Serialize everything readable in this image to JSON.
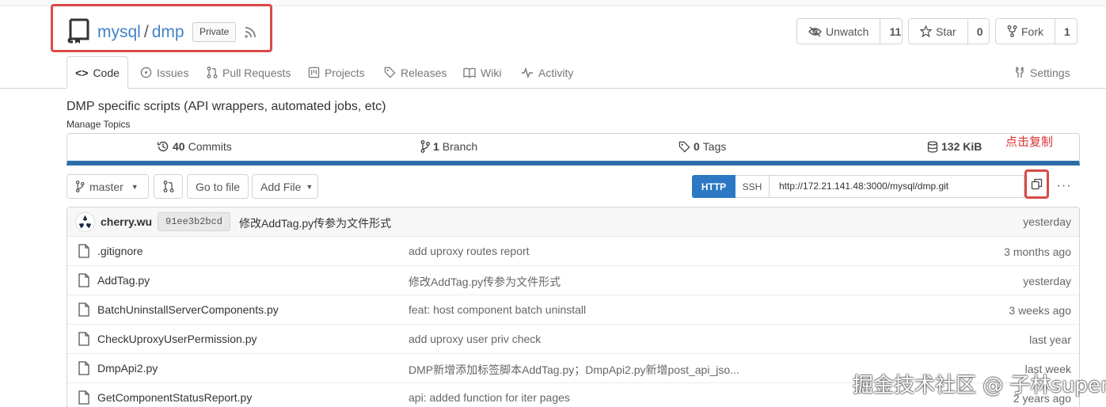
{
  "repo": {
    "owner": "mysql",
    "separator": "/",
    "name": "dmp",
    "visibility": "Private"
  },
  "actions": {
    "watch": {
      "label": "Unwatch",
      "count": "11"
    },
    "star": {
      "label": "Star",
      "count": "0"
    },
    "fork": {
      "label": "Fork",
      "count": "1"
    }
  },
  "tabs": {
    "code": "Code",
    "issues": "Issues",
    "pulls": "Pull Requests",
    "projects": "Projects",
    "releases": "Releases",
    "wiki": "Wiki",
    "activity": "Activity",
    "settings": "Settings"
  },
  "description": "DMP specific scripts (API wrappers, automated jobs, etc)",
  "manage_topics": "Manage Topics",
  "annotation": "点击复制",
  "stats": {
    "commits_count": "40",
    "commits_label": "Commits",
    "branch_count": "1",
    "branch_label": "Branch",
    "tags_count": "0",
    "tags_label": "Tags",
    "size": "132 KiB"
  },
  "toolbar": {
    "branch": "master",
    "go_to_file": "Go to file",
    "add_file": "Add File",
    "http": "HTTP",
    "ssh": "SSH",
    "clone_url": "http://172.21.141.48:3000/mysql/dmp.git",
    "more": "···"
  },
  "latest_commit": {
    "author": "cherry.wu",
    "sha": "91ee3b2bcd",
    "message": "修改AddTag.py传参为文件形式",
    "time": "yesterday"
  },
  "files": [
    {
      "name": ".gitignore",
      "message": "add uproxy routes report",
      "time": "3 months ago"
    },
    {
      "name": "AddTag.py",
      "message": "修改AddTag.py传参为文件形式",
      "time": "yesterday"
    },
    {
      "name": "BatchUninstallServerComponents.py",
      "message": "feat: host component batch uninstall",
      "time": "3 weeks ago"
    },
    {
      "name": "CheckUproxyUserPermission.py",
      "message": "add uproxy user priv check",
      "time": "last year"
    },
    {
      "name": "DmpApi2.py",
      "message": "DMP新增添加标签脚本AddTag.py；DmpApi2.py新增post_api_jso...",
      "time": "last week"
    },
    {
      "name": "GetComponentStatusReport.py",
      "message": "api: added function for iter pages",
      "time": "2 years ago"
    }
  ],
  "watermark": "掘金技术社区 @ 子林super"
}
